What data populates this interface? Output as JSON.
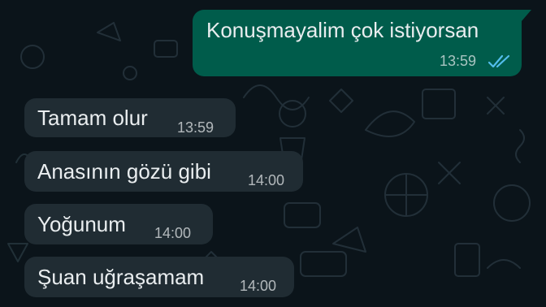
{
  "chat": {
    "background_color": "#0b141a",
    "outgoing_color": "#005c4b",
    "incoming_color": "#202c33",
    "read_tick_color": "#53bdeb",
    "messages": [
      {
        "direction": "outgoing",
        "text": "Konuşmayalim çok istiyorsan",
        "time": "13:59",
        "status": "read"
      },
      {
        "direction": "incoming",
        "text": "Tamam olur",
        "time": "13:59"
      },
      {
        "direction": "incoming",
        "text": "Anasının gözü gibi",
        "time": "14:00"
      },
      {
        "direction": "incoming",
        "text": "Yoğunum",
        "time": "14:00"
      },
      {
        "direction": "incoming",
        "text": "Şuan uğraşamam",
        "time": "14:00"
      }
    ]
  }
}
